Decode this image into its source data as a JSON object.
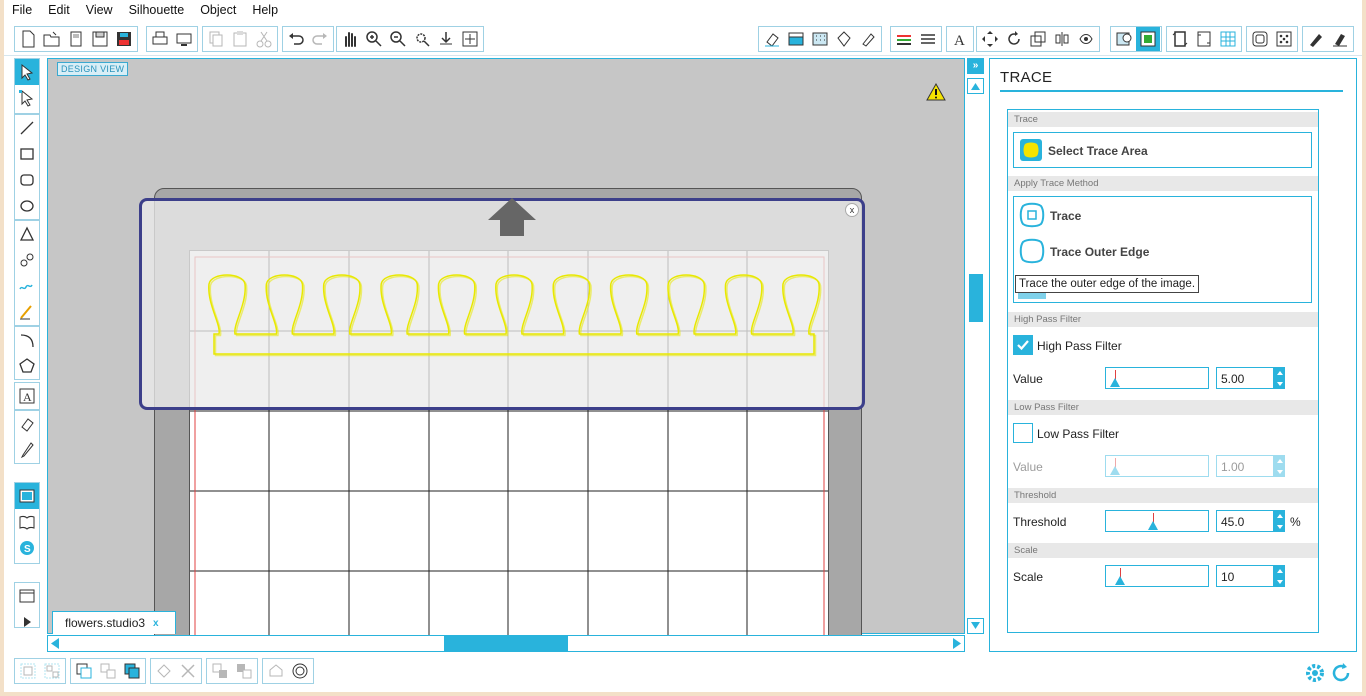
{
  "menu": {
    "items": [
      "File",
      "Edit",
      "View",
      "Silhouette",
      "Object",
      "Help"
    ]
  },
  "canvas": {
    "view_label": "DESIGN VIEW",
    "document_tab": "flowers.studio3",
    "tab_close": "x",
    "trace_close": "x"
  },
  "panel": {
    "title": "TRACE",
    "sections": {
      "trace": "Trace",
      "apply": "Apply Trace Method",
      "high": "High Pass Filter",
      "low": "Low Pass Filter",
      "threshold": "Threshold",
      "scale": "Scale"
    },
    "select_trace_area": "Select Trace Area",
    "methods": [
      "Trace",
      "Trace Outer Edge"
    ],
    "tooltip": "Trace the outer edge of the image.",
    "high_pass": {
      "label": "High Pass Filter",
      "checked": true,
      "value_label": "Value",
      "value": "5.00",
      "level": 0.05
    },
    "low_pass": {
      "label": "Low Pass Filter",
      "checked": false,
      "value_label": "Value",
      "value": "1.00",
      "level": 0.05
    },
    "threshold": {
      "label": "Threshold",
      "value": "45.0",
      "unit": "%",
      "level": 0.45
    },
    "scale": {
      "label": "Scale",
      "value": "10",
      "level": 0.1
    }
  },
  "colors": {
    "accent": "#29b3dc",
    "trace_box": "#3c3f8a",
    "cut_line": "#e8e800",
    "mat_margin": "#e04040"
  },
  "icons": [
    "new-icon",
    "open-icon",
    "template-icon",
    "save-icon",
    "save-as-icon",
    "print-icon",
    "send-to-printer-icon",
    "copy-icon",
    "paste-icon",
    "cut-icon",
    "undo-icon",
    "redo-icon",
    "pan-icon",
    "zoom-in-icon",
    "zoom-out-icon",
    "zoom-select-icon",
    "drag-zoom-icon",
    "fit-page-icon",
    "warning-icon",
    "settings-gear-icon",
    "refresh-icon"
  ]
}
